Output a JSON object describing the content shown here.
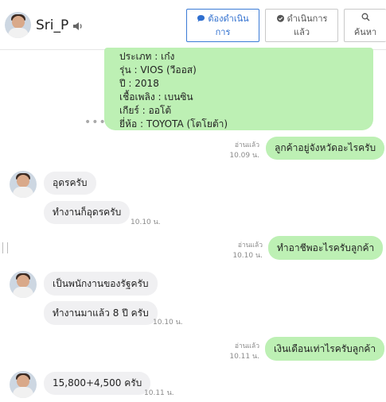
{
  "header": {
    "user_name": "Sri_P",
    "btn_in_progress": [
      "ต้องดำเนิน",
      "การ"
    ],
    "btn_done": [
      "ดำเนินการ",
      "แล้ว"
    ],
    "btn_search": "ค้นหา"
  },
  "card": {
    "lines": [
      "ประเภท : เก๋ง",
      "รุ่น : VIOS (วีออส)",
      "ปี : 2018",
      "เชื้อเพลิง : เบนซิน",
      "เกียร์ : ออโต้",
      "ยี่ห้อ : TOYOTA (โตโยต้า)"
    ]
  },
  "messages": [
    {
      "dir": "out",
      "text": "ลูกค้าอยู่จังหวัดอะไรครับ",
      "read": "อ่านแล้ว",
      "time": "10.09 น."
    },
    {
      "dir": "in",
      "text": "อุดรครับ",
      "time": ""
    },
    {
      "dir": "in",
      "text": "ทำงานก็อุดรครับ",
      "time": "10.10 น."
    },
    {
      "dir": "out",
      "text": "ทำอาชีพอะไรครับลูกค้า",
      "read": "อ่านแล้ว",
      "time": "10.10 น."
    },
    {
      "dir": "in",
      "text": "เป็นพนักงานของรัฐครับ",
      "time": ""
    },
    {
      "dir": "in",
      "text": "ทำงานมาแล้ว 8 ปี ครับ",
      "time": "10.10 น."
    },
    {
      "dir": "out",
      "text": "เงินเดือนเท่าไรครับลูกค้า",
      "read": "อ่านแล้ว",
      "time": "10.11 น."
    },
    {
      "dir": "in",
      "text": "15,800+4,500 ครับ",
      "time": "10.11 น."
    }
  ],
  "colors": {
    "outgoing_bubble": "#bdf0b4",
    "incoming_bubble": "#f0f0f2",
    "primary_button": "#2f6fcf"
  }
}
